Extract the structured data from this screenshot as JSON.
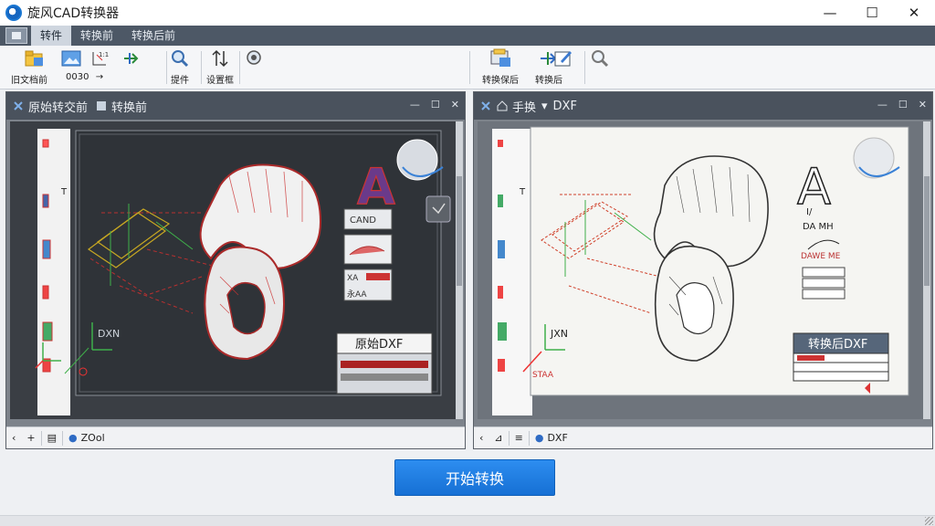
{
  "window": {
    "title": "旋风CAD转换器",
    "minimize": "—",
    "maximize": "☐",
    "close": "✕"
  },
  "menu": {
    "tabs": [
      "转件",
      "转换前",
      "转换后前"
    ]
  },
  "ribbon": {
    "left_label_1": "旧文档前",
    "left_label_2": "0030",
    "left_label_3": "提件",
    "left_label_4": "设置框",
    "right_label_1": "转换保后",
    "right_label_2": "转换后"
  },
  "left_panel": {
    "title_1": "原始转交前",
    "title_2": "转换前",
    "frame_label": "原始DXF",
    "legend_rows": [
      "CAND",
      "XA",
      "永AA"
    ],
    "axis_label": "DXN",
    "status_zoom": "ZOol"
  },
  "right_panel": {
    "title_1": "手换",
    "title_2": "DXF",
    "frame_label": "转换后DXF",
    "legend_rows": [
      "DA MH",
      "DAWE ME"
    ],
    "axis_label": "JXN",
    "axis_label_2": "STAA",
    "status_zoom": "DXF"
  },
  "actions": {
    "start": "开始转换"
  },
  "colors": {
    "accent": "#1670d4",
    "menubar": "#4d5866",
    "panel_head": "#4a525d",
    "cad_dark_bg": "#2f3338",
    "cad_light_bg": "#f5f5f2"
  }
}
